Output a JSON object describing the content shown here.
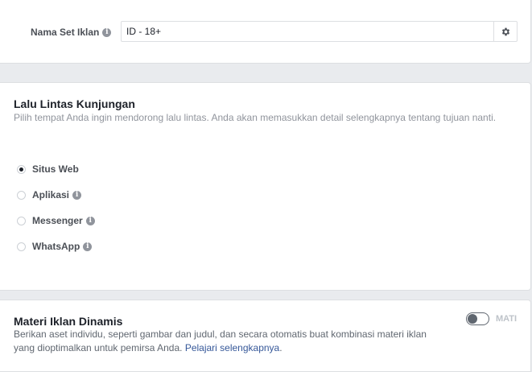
{
  "ad_set_name": {
    "label": "Nama Set Iklan",
    "value": "ID - 18+"
  },
  "traffic": {
    "title": "Lalu Lintas Kunjungan",
    "description": "Pilih tempat Anda ingin mendorong lalu lintas. Anda akan memasukkan detail selengkapnya tentang tujuan nanti.",
    "options": [
      {
        "label": "Situs Web",
        "selected": true
      },
      {
        "label": "Aplikasi",
        "selected": false
      },
      {
        "label": "Messenger",
        "selected": false
      },
      {
        "label": "WhatsApp",
        "selected": false
      }
    ]
  },
  "dynamic_creative": {
    "title": "Materi Iklan Dinamis",
    "description_line1": "Berikan aset individu, seperti gambar dan judul, dan secara otomatis buat kombinasi materi iklan",
    "description_line2": "yang dioptimalkan untuk pemirsa Anda.",
    "learn_more": "Pelajari selengkapnya",
    "learn_more_suffix": ".",
    "toggle_state": "MATI",
    "toggle_on": false
  },
  "icons": {
    "info": "i",
    "gear": "gear-icon"
  }
}
